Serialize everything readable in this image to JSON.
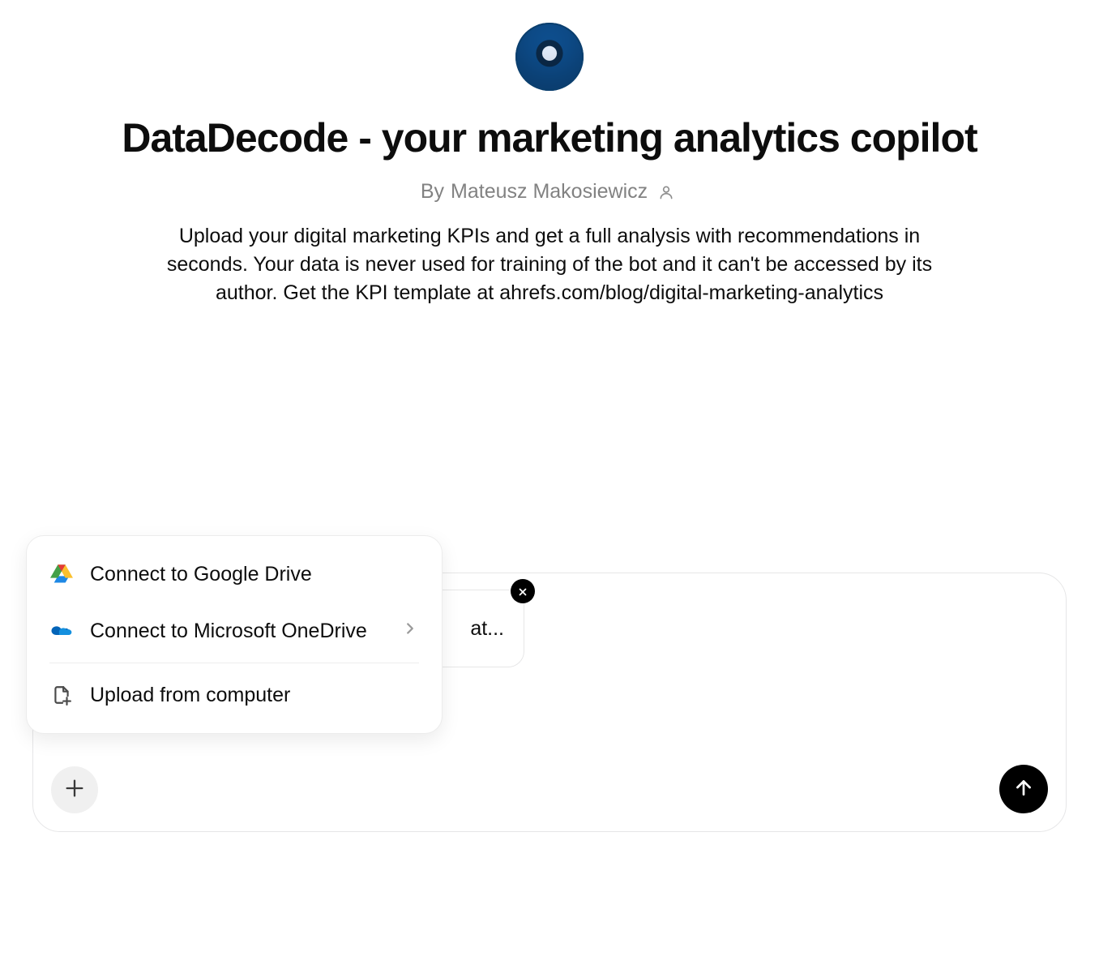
{
  "header": {
    "title": "DataDecode - your marketing analytics copilot",
    "by_prefix": "By",
    "author": "Mateusz Makosiewicz",
    "description": "Upload your digital marketing KPIs and get a full analysis with recommendations in seconds. Your data is never used for training of the bot and it can't be accessed by its author. Get the KPI template at ahrefs.com/blog/digital-marketing-analytics"
  },
  "composer": {
    "attachment_label_fragment": "at..."
  },
  "attach_menu": {
    "google_drive": "Connect to Google Drive",
    "onedrive": "Connect to Microsoft OneDrive",
    "upload": "Upload from computer"
  }
}
